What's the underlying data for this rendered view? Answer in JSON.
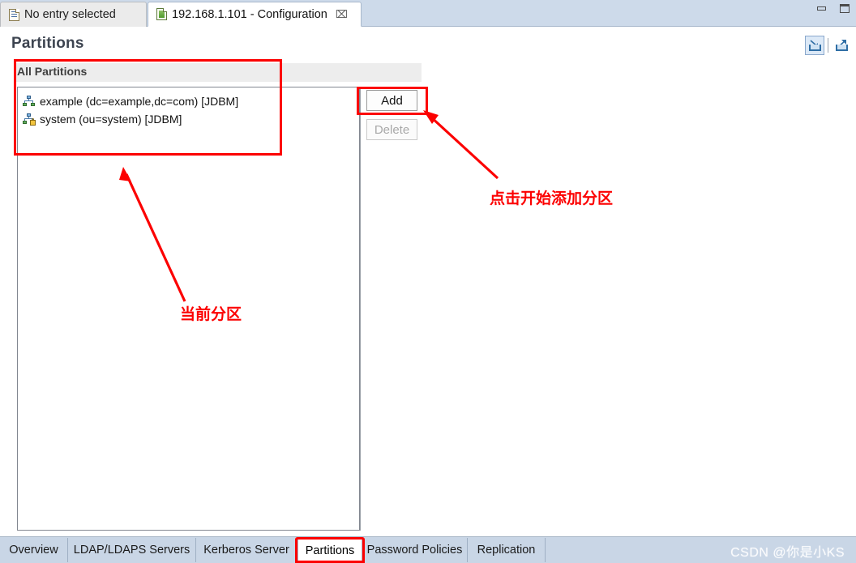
{
  "window": {
    "minimize_label": "minimize",
    "maximize_label": "maximize"
  },
  "editor_tabs": [
    {
      "label": "No entry selected",
      "icon": "document-icon",
      "active": false,
      "closable": false
    },
    {
      "label": "192.168.1.101 - Configuration",
      "icon": "green-document-icon",
      "active": true,
      "closable": true,
      "close_glyph": "⌧"
    }
  ],
  "page": {
    "title": "Partitions",
    "section_title": "All Partitions"
  },
  "header_tools": [
    {
      "name": "restore-view-icon",
      "selected": true
    },
    {
      "name": "maximize-view-icon",
      "selected": false
    }
  ],
  "partitions": [
    {
      "label": "example (dc=example,dc=com) [JDBM]",
      "icon": "partition-icon",
      "locked": false
    },
    {
      "label": "system (ou=system) [JDBM]",
      "icon": "partition-locked-icon",
      "locked": true
    }
  ],
  "buttons": {
    "add": "Add",
    "delete": "Delete",
    "delete_enabled": false
  },
  "bottom_tabs": [
    {
      "label": "Overview",
      "active": false
    },
    {
      "label": "LDAP/LDAPS Servers",
      "active": false
    },
    {
      "label": "Kerberos Server",
      "active": false
    },
    {
      "label": "Partitions",
      "active": true
    },
    {
      "label": "Password Policies",
      "active": false
    },
    {
      "label": "Replication",
      "active": false
    }
  ],
  "watermark": "CSDN @你是小KS",
  "annotations": {
    "callout_add": "点击开始添加分区",
    "callout_list": "当前分区",
    "color": "#fc0000"
  }
}
